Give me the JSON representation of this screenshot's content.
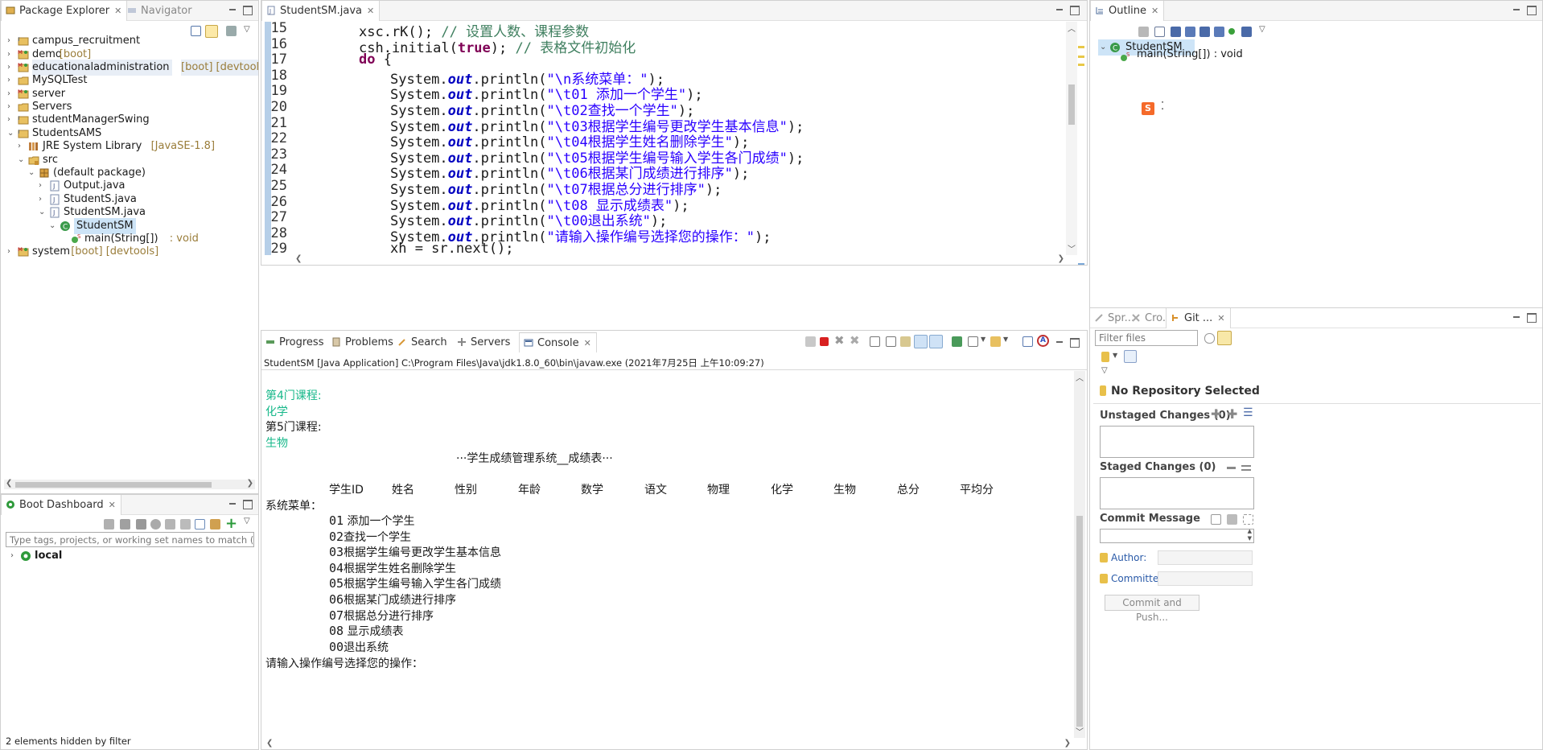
{
  "package_explorer": {
    "tab_label": "Package Explorer",
    "nav_tab_label": "Navigator",
    "items": [
      {
        "label": "campus_recruitment",
        "decoration": ""
      },
      {
        "label": "demo",
        "decoration": "[boot]"
      },
      {
        "label": "educationaladministration",
        "decoration": "[boot] [devtools]"
      },
      {
        "label": "MySQLTest",
        "decoration": ""
      },
      {
        "label": "server",
        "decoration": ""
      },
      {
        "label": "Servers",
        "decoration": ""
      },
      {
        "label": "studentManagerSwing",
        "decoration": ""
      },
      {
        "label": "StudentsAMS",
        "decoration": ""
      },
      {
        "label": "JRE System Library",
        "decoration": "[JavaSE-1.8]"
      },
      {
        "label": "src",
        "decoration": ""
      },
      {
        "label": "(default package)",
        "decoration": ""
      },
      {
        "label": "Output.java",
        "decoration": ""
      },
      {
        "label": "StudentS.java",
        "decoration": ""
      },
      {
        "label": "StudentSM.java",
        "decoration": ""
      },
      {
        "label": "StudentSM",
        "decoration": ""
      },
      {
        "label": "main(String[])",
        "decoration": ": void"
      },
      {
        "label": "system",
        "decoration": "[boot] [devtools]"
      }
    ]
  },
  "boot_dashboard": {
    "tab_label": "Boot Dashboard",
    "filter_placeholder": "Type tags, projects, or working set names to match (incl. * and",
    "item_label": "local",
    "status": "2 elements hidden by filter"
  },
  "editor": {
    "tab_label": "StudentSM.java",
    "line_numbers": [
      "15",
      "16",
      "17",
      "18",
      "19",
      "20",
      "21",
      "22",
      "23",
      "24",
      "25",
      "26",
      "27",
      "28",
      "29"
    ],
    "code": {
      "l15_a": "xsc.rK(); ",
      "l15_c": "// 设置人数、课程参数",
      "l16_a": "csh.initial(",
      "l16_kw": "true",
      "l16_b": "); ",
      "l16_c": "// 表格文件初始化",
      "l17_kw": "do",
      "l17_b": " {",
      "sys": "System.",
      "out": "out",
      "println": ".println(",
      "close": ");",
      "strings": [
        "\"\\n系统菜单：\"",
        "\"\\t01 添加一个学生\"",
        "\"\\t02查找一个学生\"",
        "\"\\t03根据学生编号更改学生基本信息\"",
        "\"\\t04根据学生姓名删除学生\"",
        "\"\\t05根据学生编号输入学生各门成绩\"",
        "\"\\t06根据某门成绩进行排序\"",
        "\"\\t07根据总分进行排序\"",
        "\"\\t08 显示成绩表\"",
        "\"\\t00退出系统\"",
        "\"请输入操作编号选择您的操作：\""
      ],
      "l29": "xh = sr.next();"
    }
  },
  "bottom_tabs": {
    "progress": "Progress",
    "problems": "Problems",
    "search": "Search",
    "servers": "Servers",
    "console": "Console"
  },
  "console": {
    "header": "StudentSM [Java Application] C:\\Program Files\\Java\\jdk1.8.0_60\\bin\\javaw.exe (2021年7月25日 上午10:09:27)",
    "lines": {
      "course4_label": "第4门课程:",
      "course4_value": "化学",
      "course5_label": "第5门课程:",
      "course5_value": "生物",
      "table_title": "···学生成绩管理系统__成绩表···",
      "menu_title": "系统菜单：",
      "prompt": "请输入操作编号选择您的操作："
    },
    "table_headers": [
      "学生ID",
      "姓名",
      "性别",
      "年龄",
      "数学",
      "语文",
      "物理",
      "化学",
      "生物",
      "总分",
      "平均分"
    ],
    "menu_items": [
      {
        "num": "01",
        "text": " 添加一个学生"
      },
      {
        "num": "02",
        "text": "查找一个学生"
      },
      {
        "num": "03",
        "text": "根据学生编号更改学生基本信息"
      },
      {
        "num": "04",
        "text": "根据学生姓名删除学生"
      },
      {
        "num": "05",
        "text": "根据学生编号输入学生各门成绩"
      },
      {
        "num": "06",
        "text": "根据某门成绩进行排序"
      },
      {
        "num": "07",
        "text": "根据总分进行排序"
      },
      {
        "num": "08",
        "text": " 显示成绩表"
      },
      {
        "num": "00",
        "text": "退出系统"
      }
    ]
  },
  "outline": {
    "tab_label": "Outline",
    "class_label": "StudentSM",
    "method_label": "main(String[]) : void"
  },
  "git": {
    "tab_spr": "Spr...",
    "tab_cro": "Cro...",
    "tab_git": "Git ...",
    "filter_placeholder": "Filter files",
    "no_repo": "No Repository Selected",
    "unstaged": "Unstaged Changes (0)",
    "staged": "Staged Changes (0)",
    "commit_message": "Commit Message",
    "author": "Author:",
    "committer": "Committer:",
    "commit_push": "Commit and Push..."
  }
}
